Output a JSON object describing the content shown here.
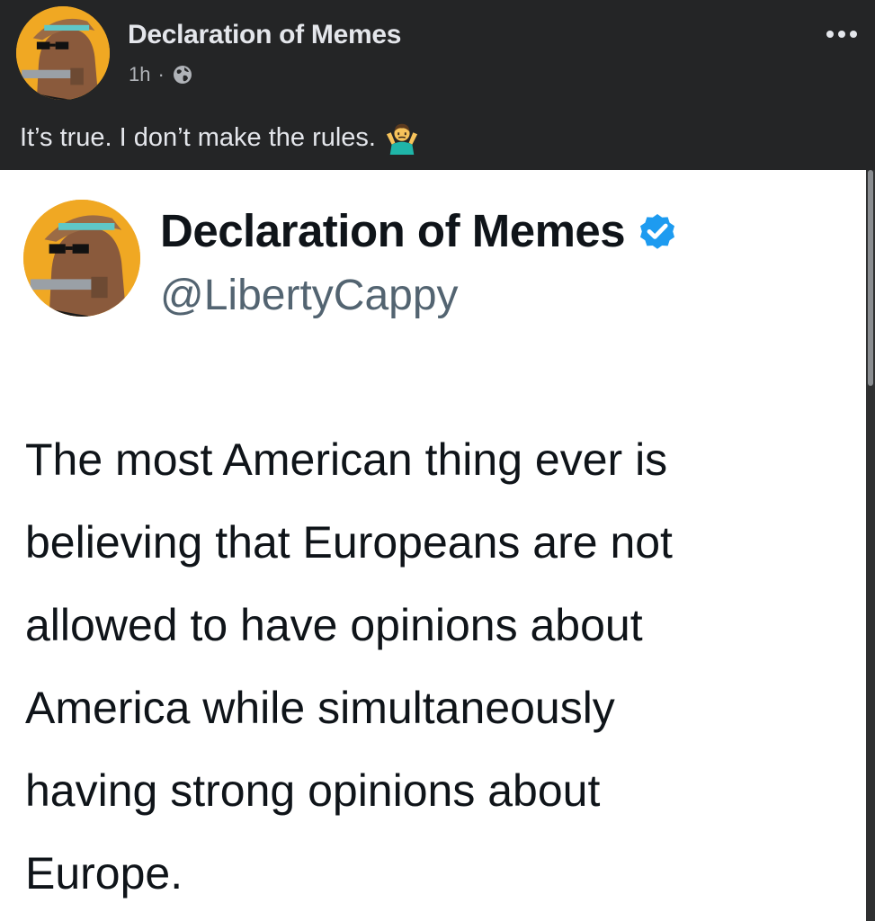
{
  "post": {
    "page_name": "Declaration of Memes",
    "timestamp": "1h",
    "separator": "·",
    "privacy_icon": "globe-icon",
    "more_icon": "more-options-icon",
    "caption": "It’s true. I don’t make the rules.",
    "caption_emoji": "person-shrugging-emoji"
  },
  "tweet": {
    "display_name": "Declaration of Memes",
    "verified_icon": "verified-badge-icon",
    "handle": "@LibertyCappy",
    "text_lines": [
      "The most American thing ever is",
      "believing that Europeans are not",
      "allowed to have opinions about",
      "America while simultaneously",
      "having strong opinions about",
      "Europe."
    ]
  },
  "colors": {
    "header_bg": "#242526",
    "header_text": "#e4e6eb",
    "meta_text": "#b0b3b8",
    "verified_blue": "#1d9bf0",
    "avatar_bg": "#f0a823",
    "tweet_text": "#0f1419",
    "handle_text": "#536471"
  }
}
